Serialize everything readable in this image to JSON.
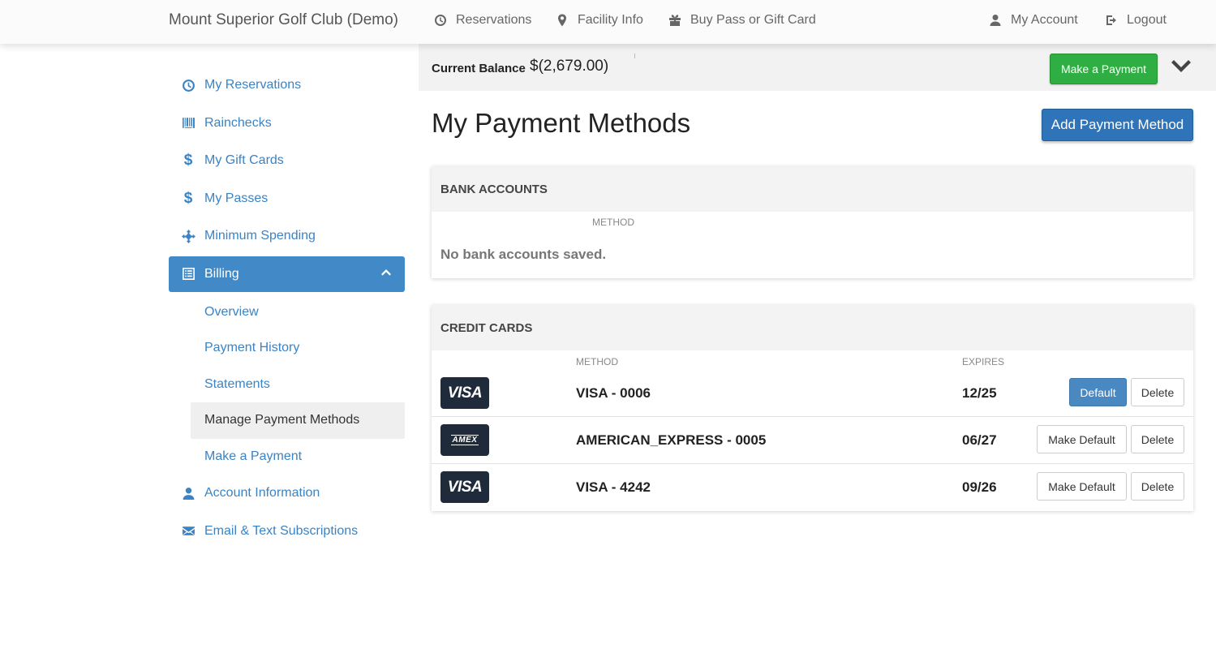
{
  "navbar": {
    "brand": "Mount Superior Golf Club (Demo)",
    "reservations": "Reservations",
    "facility_info": "Facility Info",
    "buy_pass": "Buy Pass or Gift Card",
    "my_account": "My Account",
    "logout": "Logout"
  },
  "sidebar": {
    "items": [
      {
        "label": "My Reservations",
        "icon": "clock-icon"
      },
      {
        "label": "Rainchecks",
        "icon": "barcode-icon"
      },
      {
        "label": "My Gift Cards",
        "icon": "dollar-icon"
      },
      {
        "label": "My Passes",
        "icon": "dollar-icon"
      },
      {
        "label": "Minimum Spending",
        "icon": "crosshair-icon"
      },
      {
        "label": "Billing",
        "icon": "list-icon"
      },
      {
        "label": "Account Information",
        "icon": "user-icon"
      },
      {
        "label": "Email & Text Subscriptions",
        "icon": "envelope-icon"
      }
    ],
    "billing_sub": [
      {
        "label": "Overview"
      },
      {
        "label": "Payment History"
      },
      {
        "label": "Statements"
      },
      {
        "label": "Manage Payment Methods"
      },
      {
        "label": "Make a Payment"
      }
    ]
  },
  "balance": {
    "label": "Current Balance",
    "value": "$(2,679.00)",
    "pay_button": "Make a Payment"
  },
  "main": {
    "title": "My Payment Methods",
    "add_button": "Add Payment Method",
    "bank": {
      "heading": "BANK ACCOUNTS",
      "col_method": "METHOD",
      "empty": "No bank accounts saved."
    },
    "cards": {
      "heading": "CREDIT CARDS",
      "col_method": "METHOD",
      "col_expires": "EXPIRES",
      "rows": [
        {
          "logo": "VISA",
          "method": "VISA - 0006",
          "expires": "12/25",
          "action": "Default",
          "delete": "Delete"
        },
        {
          "logo": "AMEX",
          "method": "AMERICAN_EXPRESS - 0005",
          "expires": "06/27",
          "action": "Make Default",
          "delete": "Delete"
        },
        {
          "logo": "VISA",
          "method": "VISA - 4242",
          "expires": "09/26",
          "action": "Make Default",
          "delete": "Delete"
        }
      ]
    }
  },
  "colors": {
    "link_blue": "#3a83c4",
    "active_blue": "#4189c7",
    "pay_green": "#2fae43",
    "primary_blue": "#2f74b8",
    "card_dark": "#1f2a3a"
  }
}
